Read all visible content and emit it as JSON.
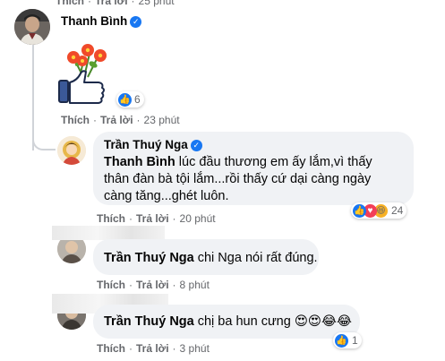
{
  "top_actions": {
    "like": "Thích",
    "reply": "Trả lời",
    "time": "25 phút"
  },
  "comment1": {
    "author": "Thanh Bình",
    "reaction_count": "6",
    "actions": {
      "like": "Thích",
      "reply": "Trả lời",
      "time": "23 phút"
    }
  },
  "reply1": {
    "author": "Trần Thuý Nga",
    "text": "Thanh Bình lúc đầu thương em ấy lắm,vì thấy thân đàn bà tội lắm...rồi thấy cứ dại càng ngày càng tăng...ghét luôn.",
    "mention": "Thanh Bình",
    "body": " lúc đầu thương em ấy lắm,vì thấy thân đàn bà tội lắm...rồi thấy cứ dại càng ngày càng tăng...ghét luôn.",
    "reaction_count": "24",
    "actions": {
      "like": "Thích",
      "reply": "Trả lời",
      "time": "20 phút"
    }
  },
  "reply2": {
    "mention": "Trần Thuý Nga",
    "body": " chi Nga nói rất đúng.",
    "actions": {
      "like": "Thích",
      "reply": "Trả lời",
      "time": "8 phút"
    }
  },
  "reply3": {
    "mention": "Trần Thuý Nga",
    "body": " chị ba hun cưng ",
    "emojis": "😍😍😂😂",
    "reaction_count": "1",
    "actions": {
      "like": "Thích",
      "reply": "Trả lời",
      "time": "3 phút"
    }
  },
  "colors": {
    "link": "#050505",
    "meta": "#65676b",
    "bubble": "#f0f2f5",
    "like_blue": "#1877f2",
    "verified": "#1877f2"
  }
}
